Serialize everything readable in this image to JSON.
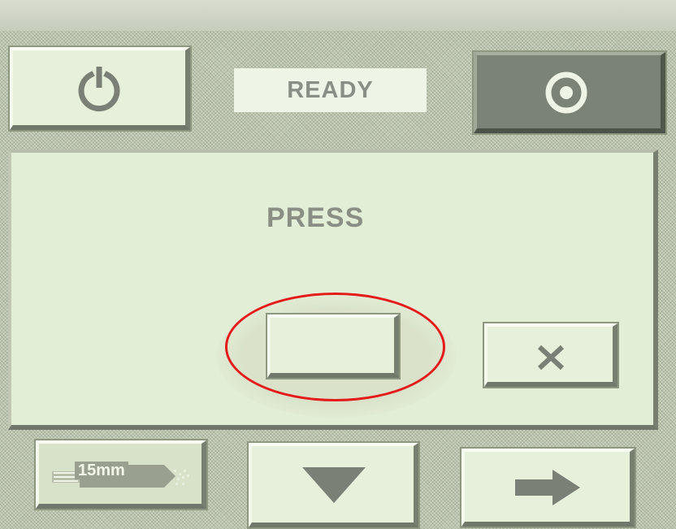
{
  "header": {
    "power_icon": "power-icon",
    "status_label": "READY",
    "stop_icon": "record-stop-icon"
  },
  "dialog": {
    "prompt": "PRESS",
    "confirm_button_label": "",
    "cancel_icon": "x-icon",
    "annotation_color": "#e41b1b"
  },
  "footer": {
    "cable_label": "15mm",
    "cable_icon": "cable-strip-icon",
    "down_icon": "down-triangle-icon",
    "next_icon": "right-arrow-icon"
  },
  "colors": {
    "lcd_background": "#e3eed6",
    "text": "#8a8f86",
    "dark_button": "#7a8376"
  }
}
